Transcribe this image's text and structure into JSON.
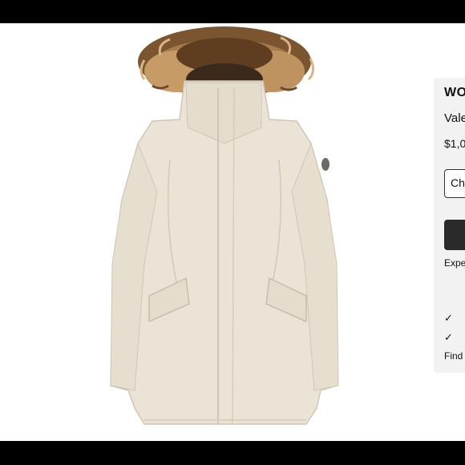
{
  "product": {
    "brand": "WO",
    "name": "Vale",
    "price": "$1,0",
    "choose_label": "Cho",
    "expect_text": "Expe",
    "checks": [
      "✓",
      "✓"
    ],
    "find_text": "Find c"
  },
  "colors": {
    "jacket": "#ebe4d6",
    "fur": "#8a6238",
    "button_dark": "#2a2a2a",
    "panel_bg": "#f2f2f2"
  }
}
